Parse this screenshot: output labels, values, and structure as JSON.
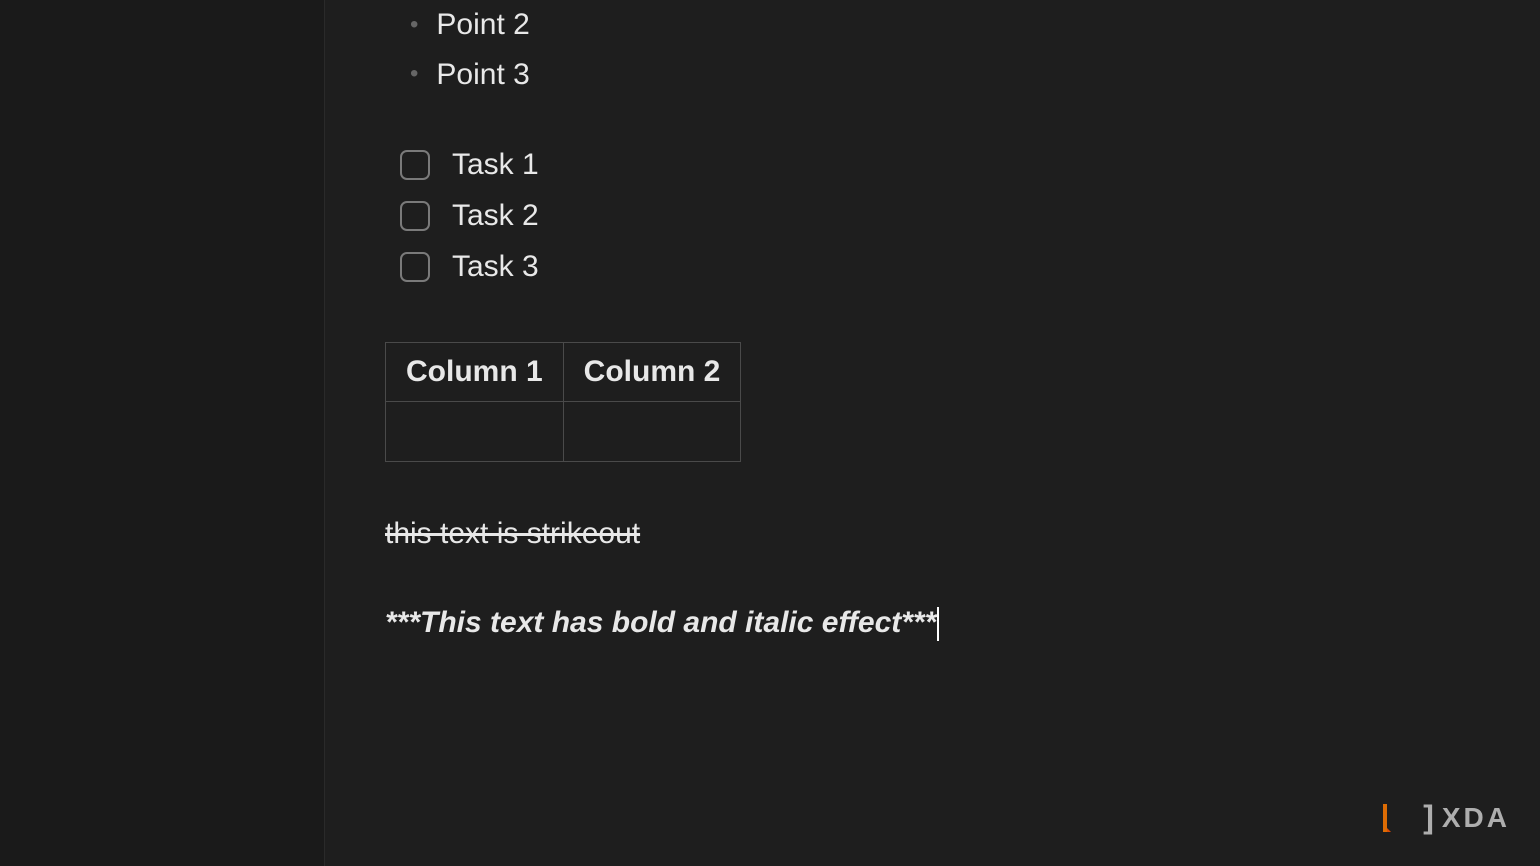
{
  "bullet_points": [
    "Point 2",
    "Point 3"
  ],
  "tasks": [
    "Task 1",
    "Task 2",
    "Task 3"
  ],
  "table": {
    "headers": [
      "Column 1",
      "Column 2"
    ],
    "rows": [
      [
        "",
        ""
      ]
    ]
  },
  "strikethrough_text": "this text is strikeout",
  "bold_italic_text": "***This text has bold and italic effect***",
  "watermark": {
    "brand": "XDA"
  }
}
